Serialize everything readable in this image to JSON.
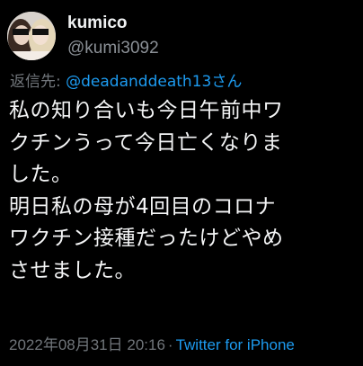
{
  "tweet": {
    "author": {
      "display_name": "kumico",
      "handle": "@kumi3092",
      "avatar_icon": "profile-photo"
    },
    "reply": {
      "label": "返信先: ",
      "user": "@deadanddeath13さん"
    },
    "body_lines": [
      "私の知り合いも今日午前中ワ",
      "クチンうって今日亡くなりま",
      "した。",
      "明日私の母が4回目のコロナ",
      "ワクチン接種だったけどやめ",
      "させました。"
    ],
    "timestamp": "2022年08月31日 20:16",
    "separator": "·",
    "source": "Twitter for iPhone"
  },
  "colors": {
    "background": "#000000",
    "text": "#e7e9ea",
    "secondary": "#71767b",
    "link": "#1d9bf0"
  }
}
